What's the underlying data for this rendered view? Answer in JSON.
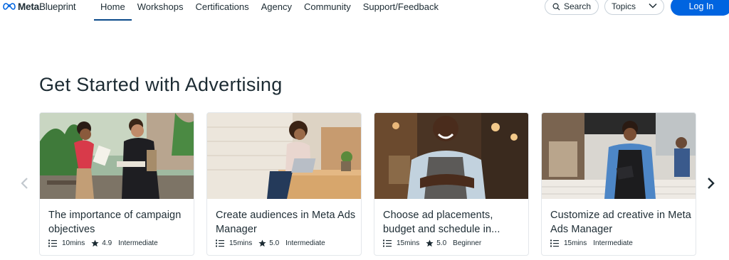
{
  "header": {
    "logo_bold": "Meta",
    "logo_light": "Blueprint",
    "nav": [
      {
        "label": "Home",
        "active": true
      },
      {
        "label": "Workshops",
        "active": false
      },
      {
        "label": "Certifications",
        "active": false
      },
      {
        "label": "Agency",
        "active": false
      },
      {
        "label": "Community",
        "active": false
      },
      {
        "label": "Support/Feedback",
        "active": false
      }
    ],
    "search_label": "Search",
    "topics_label": "Topics",
    "login_label": "Log In"
  },
  "section": {
    "title": "Get Started with Advertising",
    "cards": [
      {
        "title": "The importance of campaign objectives",
        "duration": "10mins",
        "rating": "4.9",
        "level": "Intermediate"
      },
      {
        "title": "Create audiences in Meta Ads Manager",
        "duration": "15mins",
        "rating": "5.0",
        "level": "Intermediate"
      },
      {
        "title": "Choose ad placements, budget and schedule in...",
        "duration": "15mins",
        "rating": "5.0",
        "level": "Beginner"
      },
      {
        "title": "Customize ad creative in Meta Ads Manager",
        "duration": "15mins",
        "rating": "",
        "level": "Intermediate"
      }
    ]
  },
  "colors": {
    "brand": "#0064e0",
    "text": "#1c2b33",
    "nav_underline": "#0a4a8a"
  },
  "icons": [
    "meta-infinity-icon",
    "search-icon",
    "chevron-down-icon",
    "chevron-left-icon",
    "chevron-right-icon",
    "list-icon",
    "star-icon"
  ]
}
